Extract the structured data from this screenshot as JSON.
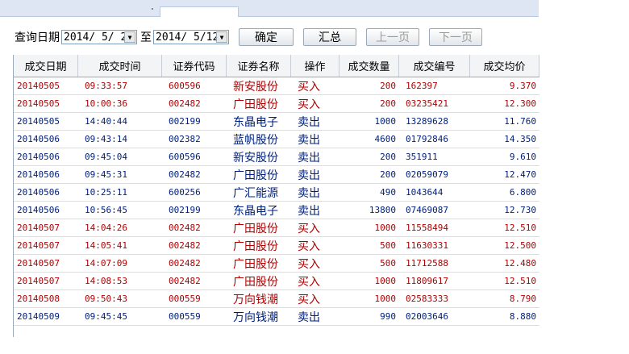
{
  "toolbar": {
    "query_date_label": "查询日期",
    "start_date": "2014/ 5/ 2",
    "to_label": "至",
    "end_date": "2014/ 5/12",
    "confirm_label": "确定",
    "summary_label": "汇总",
    "prev_label": "上一页",
    "next_label": "下一页"
  },
  "table": {
    "headers": [
      "成交日期",
      "成交时间",
      "证券代码",
      "证券名称",
      "操作",
      "成交数量",
      "成交编号",
      "成交均价"
    ],
    "rows": [
      {
        "type": "buy",
        "cells": [
          "20140505",
          "09:33:57",
          "600596",
          "新安股份",
          "买入",
          "200",
          "162397",
          "9.370"
        ]
      },
      {
        "type": "buy",
        "cells": [
          "20140505",
          "10:00:36",
          "002482",
          "广田股份",
          "买入",
          "200",
          "03235421",
          "12.300"
        ]
      },
      {
        "type": "sell",
        "cells": [
          "20140505",
          "14:40:44",
          "002199",
          "东晶电子",
          "卖出",
          "1000",
          "13289628",
          "11.760"
        ]
      },
      {
        "type": "sell",
        "cells": [
          "20140506",
          "09:43:14",
          "002382",
          "蓝帆股份",
          "卖出",
          "4600",
          "01792846",
          "14.350"
        ]
      },
      {
        "type": "sell",
        "cells": [
          "20140506",
          "09:45:04",
          "600596",
          "新安股份",
          "卖出",
          "200",
          "351911",
          "9.610"
        ]
      },
      {
        "type": "sell",
        "cells": [
          "20140506",
          "09:45:31",
          "002482",
          "广田股份",
          "卖出",
          "200",
          "02059079",
          "12.470"
        ]
      },
      {
        "type": "sell",
        "cells": [
          "20140506",
          "10:25:11",
          "600256",
          "广汇能源",
          "卖出",
          "490",
          "1043644",
          "6.800"
        ]
      },
      {
        "type": "sell",
        "cells": [
          "20140506",
          "10:56:45",
          "002199",
          "东晶电子",
          "卖出",
          "13800",
          "07469087",
          "12.730"
        ]
      },
      {
        "type": "buy",
        "cells": [
          "20140507",
          "14:04:26",
          "002482",
          "广田股份",
          "买入",
          "1000",
          "11558494",
          "12.510"
        ]
      },
      {
        "type": "buy",
        "cells": [
          "20140507",
          "14:05:41",
          "002482",
          "广田股份",
          "买入",
          "500",
          "11630331",
          "12.500"
        ]
      },
      {
        "type": "buy",
        "cells": [
          "20140507",
          "14:07:09",
          "002482",
          "广田股份",
          "买入",
          "500",
          "11712588",
          "12.480"
        ]
      },
      {
        "type": "buy",
        "cells": [
          "20140507",
          "14:08:53",
          "002482",
          "广田股份",
          "买入",
          "1000",
          "11809617",
          "12.510"
        ]
      },
      {
        "type": "buy",
        "cells": [
          "20140508",
          "09:50:43",
          "000559",
          "万向钱潮",
          "买入",
          "1000",
          "02583333",
          "8.790"
        ]
      },
      {
        "type": "sell",
        "cells": [
          "20140509",
          "09:45:45",
          "000559",
          "万向钱潮",
          "卖出",
          "990",
          "02003646",
          "8.880"
        ]
      }
    ]
  },
  "colors": {
    "buy": "#b00000",
    "sell": "#00207f"
  }
}
